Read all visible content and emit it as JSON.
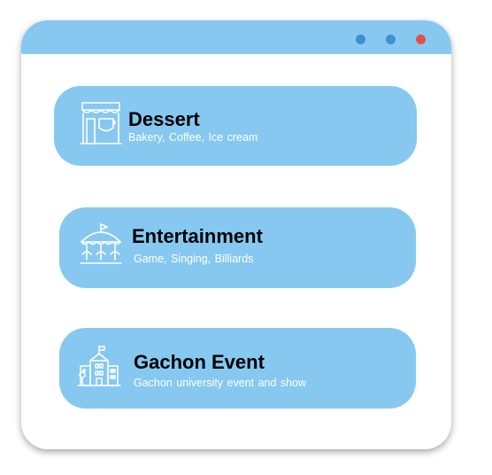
{
  "colors": {
    "titlebar": "#86c8f0",
    "card": "#86c8f0",
    "dot_blue": "#3f8fd6",
    "dot_red": "#e0504a",
    "icon_stroke": "#ffffff"
  },
  "window": {
    "controls": [
      {
        "name": "window-dot-blue-1",
        "color": "#3f8fd6"
      },
      {
        "name": "window-dot-blue-2",
        "color": "#3f8fd6"
      },
      {
        "name": "window-dot-red",
        "color": "#e0504a"
      }
    ]
  },
  "menu": {
    "items": [
      {
        "icon": "shop-icon",
        "title": "Dessert",
        "subtitle": "Bakery, Coffee, Ice cream"
      },
      {
        "icon": "carousel-icon",
        "title": "Entertainment",
        "subtitle": "Game, Singing, Billiards"
      },
      {
        "icon": "school-building-icon",
        "title": "Gachon Event",
        "subtitle": "Gachon university event and show"
      }
    ]
  }
}
